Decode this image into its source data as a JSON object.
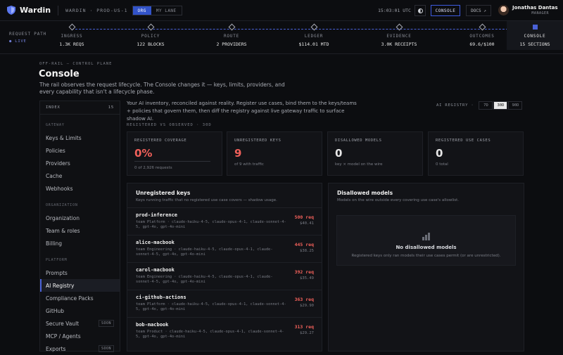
{
  "app": {
    "name": "Wardin",
    "breadcrumb": "WARDIN · PROD-US-1",
    "scope_options": [
      "ORG",
      "MY LANE"
    ],
    "scope_selected": "ORG"
  },
  "topbar": {
    "time": "15:03:01 UTC",
    "console_label": "CONSOLE",
    "docs_label": "DOCS ↗",
    "user_name": "Jonathas Dantas",
    "user_role": "MANAGER"
  },
  "pipeline": {
    "label": "REQUEST PATH",
    "live": "● LIVE",
    "stages": [
      {
        "name": "INGRESS",
        "value": "1.3K REQS"
      },
      {
        "name": "POLICY",
        "value": "122 BLOCKS"
      },
      {
        "name": "ROUTE",
        "value": "2 PROVIDERS"
      },
      {
        "name": "LEDGER",
        "value": "$114.01 MTD"
      },
      {
        "name": "EVIDENCE",
        "value": "3.0K RECEIPTS"
      },
      {
        "name": "OUTCOMES",
        "value": "69.6/$100"
      },
      {
        "name": "CONSOLE",
        "value": "15 SECTIONS"
      }
    ],
    "active_stage": "CONSOLE"
  },
  "header": {
    "eyebrow": "OFF-RAIL — CONTROL PLANE",
    "title": "Console",
    "description": "The rail observes the request lifecycle. The Console changes it — keys, limits, providers, and every capability that isn't a lifecycle phase."
  },
  "sidebar": {
    "index_label": "INDEX",
    "index_count": "15",
    "groups": [
      {
        "label": "GATEWAY",
        "items": [
          {
            "label": "Keys & Limits"
          },
          {
            "label": "Policies"
          },
          {
            "label": "Providers"
          },
          {
            "label": "Cache"
          },
          {
            "label": "Webhooks"
          }
        ]
      },
      {
        "label": "ORGANIZATION",
        "items": [
          {
            "label": "Organization"
          },
          {
            "label": "Team & roles"
          },
          {
            "label": "Billing"
          }
        ]
      },
      {
        "label": "PLATFORM",
        "items": [
          {
            "label": "Prompts"
          },
          {
            "label": "AI Registry"
          },
          {
            "label": "Compliance Packs"
          },
          {
            "label": "GitHub"
          },
          {
            "label": "Secure Vault",
            "badge": "SOON"
          },
          {
            "label": "MCP / Agents"
          },
          {
            "label": "Exports",
            "badge": "SOON"
          }
        ]
      }
    ],
    "selected": "AI Registry"
  },
  "main": {
    "intro": "Your AI inventory, reconciled against reality. Register use cases, bind them to the keys/teams + policies that govern them, then diff the registry against live gateway traffic to surface shadow AI.",
    "range_label": "AI REGISTRY ·",
    "range_options": [
      "7D",
      "30D",
      "90D"
    ],
    "range_selected": "30D",
    "section_label": "REGISTERED VS OBSERVED · 30D",
    "cards": [
      {
        "label": "REGISTERED COVERAGE",
        "value": "0%",
        "sub": "0 of 2,926 requests",
        "accent": "#f0605a",
        "progress": 0
      },
      {
        "label": "UNREGISTERED KEYS",
        "value": "9",
        "sub": "of 9 with traffic",
        "accent": "#f0605a"
      },
      {
        "label": "DISALLOWED MODELS",
        "value": "0",
        "sub": "key × model on the wire",
        "accent": "#f5f5f5"
      },
      {
        "label": "REGISTERED USE CASES",
        "value": "0",
        "sub": "0 total",
        "accent": "#f5f5f5"
      }
    ],
    "unregistered": {
      "title": "Unregistered keys",
      "subtitle": "Keys running traffic that no registered use case covers — shadow usage.",
      "rows": [
        {
          "name": "prod-inference",
          "meta": "team Platform · claude-haiku-4-5, claude-opus-4-1, claude-sonnet-4-5, gpt-4o, gpt-4o-mini",
          "req": "500 req",
          "cost": "$40.41"
        },
        {
          "name": "alice-macbook",
          "meta": "team Engineering · claude-haiku-4-5, claude-opus-4-1, claude-sonnet-4-5, gpt-4o, gpt-4o-mini",
          "req": "445 req",
          "cost": "$38.25"
        },
        {
          "name": "carol-macbook",
          "meta": "team Engineering · claude-haiku-4-5, claude-opus-4-1, claude-sonnet-4-5, gpt-4o, gpt-4o-mini",
          "req": "392 req",
          "cost": "$35.49"
        },
        {
          "name": "ci-github-actions",
          "meta": "team Platform · claude-haiku-4-5, claude-opus-4-1, claude-sonnet-4-5, gpt-4o, gpt-4o-mini",
          "req": "363 req",
          "cost": "$29.90"
        },
        {
          "name": "bob-macbook",
          "meta": "team Product · claude-haiku-4-5, claude-opus-4-1, claude-sonnet-4-5, gpt-4o, gpt-4o-mini",
          "req": "313 req",
          "cost": "$29.27"
        }
      ]
    },
    "disallowed": {
      "title": "Disallowed models",
      "subtitle": "Models on the wire outside every covering use case's allowlist.",
      "empty_title": "No disallowed models",
      "empty_sub": "Registered keys only ran models their use cases permit (or are unrestricted)."
    }
  }
}
